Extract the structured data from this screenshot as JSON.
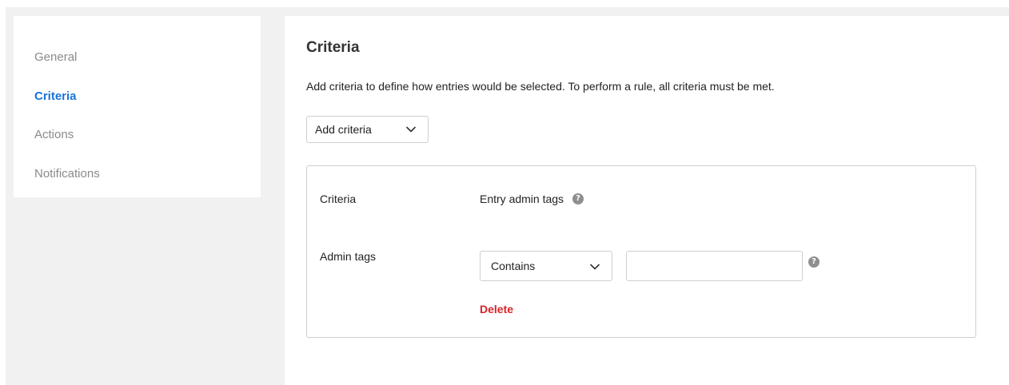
{
  "sidebar": {
    "items": [
      {
        "label": "General",
        "active": false
      },
      {
        "label": "Criteria",
        "active": true
      },
      {
        "label": "Actions",
        "active": false
      },
      {
        "label": "Notifications",
        "active": false
      }
    ]
  },
  "main": {
    "title": "Criteria",
    "description": "Add criteria to define how entries would be selected. To perform a rule, all criteria must be met.",
    "add_button_label": "Add criteria",
    "criteria_block": {
      "criteria_label": "Criteria",
      "criteria_value": "Entry admin tags",
      "admin_tags_label": "Admin tags",
      "operator_selected": "Contains",
      "tag_input_value": "",
      "delete_label": "Delete"
    }
  },
  "icons": {
    "help": "question-mark-circle-icon",
    "chevron": "chevron-down-icon"
  },
  "colors": {
    "accent": "#1a73d8",
    "danger": "#d8232a",
    "muted_text": "#8a8a8a",
    "background": "#f1f1f1"
  }
}
